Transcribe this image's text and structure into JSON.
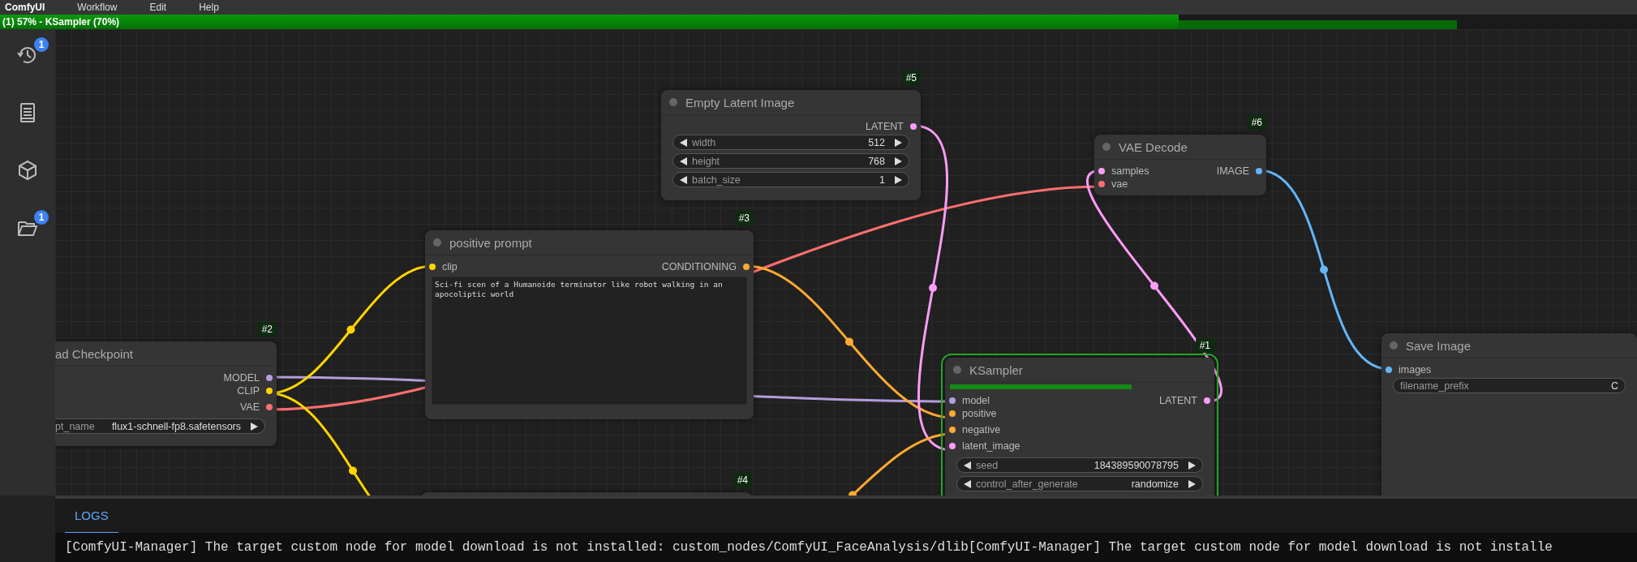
{
  "menu_bar": {
    "logo": "ComfyUI",
    "items": [
      "Workflow",
      "Edit",
      "Help"
    ]
  },
  "progress": {
    "text": "(1) 57% - KSampler (70%)",
    "level": 0.72,
    "node": {
      "level": 0.89
    }
  },
  "sidebar": {
    "items": [
      {
        "kind": "queue",
        "badge": "1"
      },
      {
        "kind": "library"
      },
      {
        "kind": "models"
      },
      {
        "kind": "workflows",
        "badge": "1"
      }
    ]
  },
  "nodes": [
    {
      "id": "#5",
      "title": "Empty Latent Image",
      "running": false,
      "outputs": [
        {
          "name": "LATENT",
          "color": "#ff9cf9"
        }
      ],
      "widgets": [
        {
          "kind": "number",
          "name": "width",
          "value": "512"
        },
        {
          "kind": "number",
          "name": "height",
          "value": "768"
        },
        {
          "kind": "number",
          "name": "batch_size",
          "value": "1"
        }
      ]
    },
    {
      "id": "#3",
      "title": "positive prompt",
      "running": false,
      "inputs": [
        {
          "name": "clip",
          "color": "#ffd500"
        }
      ],
      "outputs": [
        {
          "name": "CONDITIONING",
          "color": "#ffa931"
        }
      ],
      "text": "Sci-fi scen of a Humanoide terminator like robot walking in an apocoliptic world"
    },
    {
      "id": "#2",
      "title": "ad Checkpoint",
      "running": false,
      "outputs": [
        {
          "name": "MODEL",
          "color": "#b39ddb"
        },
        {
          "name": "CLIP",
          "color": "#ffd500"
        },
        {
          "name": "VAE",
          "color": "#ff6e6e"
        }
      ],
      "widgets": [
        {
          "kind": "combo",
          "name": "pt_name",
          "value": "flux1-schnell-fp8.safetensors"
        }
      ]
    },
    {
      "id": "#4",
      "running": false
    },
    {
      "id": "#6",
      "title": "VAE Decode",
      "running": false,
      "inputs": [
        {
          "name": "samples",
          "color": "#ff9cf9"
        },
        {
          "name": "vae",
          "color": "#ff6e6e"
        }
      ],
      "outputs": [
        {
          "name": "IMAGE",
          "color": "#64b5f6"
        }
      ]
    },
    {
      "id": "#1",
      "title": "KSampler",
      "running": true,
      "level": 0.7,
      "inputs": [
        {
          "name": "model",
          "color": "#b39ddb"
        },
        {
          "name": "positive",
          "color": "#ffa931"
        },
        {
          "name": "negative",
          "color": "#ffa931"
        },
        {
          "name": "latent_image",
          "color": "#ff9cf9"
        }
      ],
      "outputs": [
        {
          "name": "LATENT",
          "color": "#ff9cf9"
        }
      ],
      "widgets": [
        {
          "kind": "number",
          "name": "seed",
          "value": "184389590078795"
        },
        {
          "kind": "combo",
          "name": "control_after_generate",
          "value": "randomize"
        }
      ]
    },
    {
      "title": "Save Image",
      "running": false,
      "inputs": [
        {
          "name": "images",
          "color": "#64b5f6"
        }
      ],
      "widgets": [
        {
          "kind": "text",
          "name": "filename_prefix",
          "value": "C"
        }
      ]
    }
  ],
  "logs": {
    "tabs": [
      {
        "label": "LOGS",
        "selected": true
      }
    ],
    "line": "[ComfyUI-Manager] The target custom node for model download is not installed: custom_nodes/ComfyUI_FaceAnalysis/dlib[ComfyUI-Manager] The target custom node for model download is not installe"
  }
}
